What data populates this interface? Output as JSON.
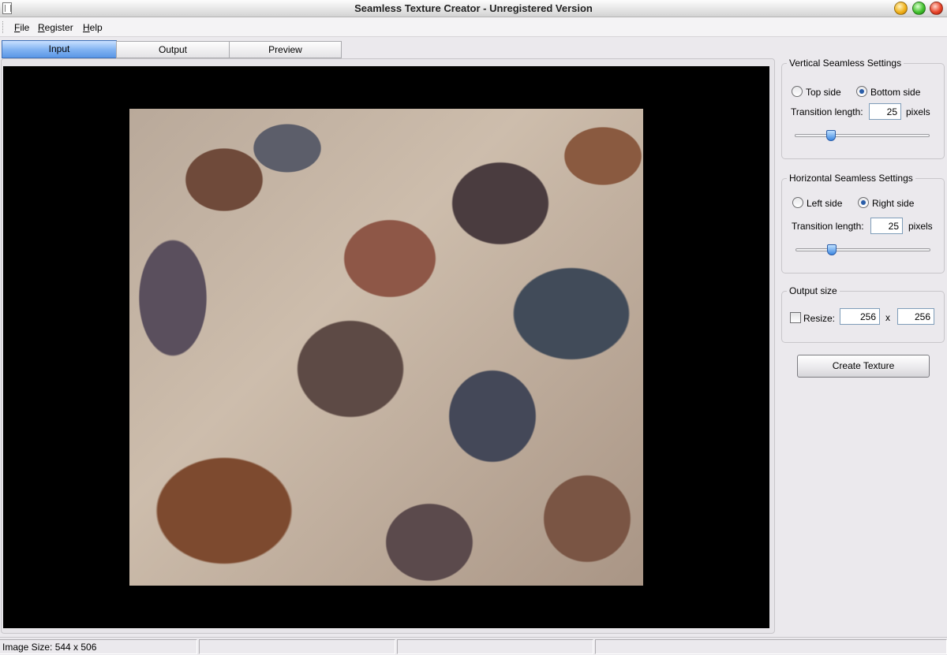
{
  "window": {
    "title": "Seamless Texture Creator - Unregistered Version"
  },
  "menu": {
    "items": [
      "File",
      "Register",
      "Help"
    ]
  },
  "tabs": [
    {
      "label": "Input",
      "active": true
    },
    {
      "label": "Output",
      "active": false
    },
    {
      "label": "Preview",
      "active": false
    }
  ],
  "vertical": {
    "title": "Vertical Seamless Settings",
    "option_top": "Top side",
    "option_bottom": "Bottom side",
    "selected": "Bottom side",
    "transition_label": "Transition length:",
    "transition_value": "25",
    "units": "pixels",
    "slider_fraction": 0.25
  },
  "horizontal": {
    "title": "Horizontal Seamless Settings",
    "option_left": "Left side",
    "option_right": "Right side",
    "selected": "Right side",
    "transition_label": "Transition length:",
    "transition_value": "25",
    "units": "pixels",
    "slider_fraction": 0.25
  },
  "output_size": {
    "title": "Output size",
    "resize_label": "Resize:",
    "resize_checked": false,
    "width": "256",
    "separator": "x",
    "height": "256"
  },
  "create_button": "Create Texture",
  "status": {
    "image_size": "Image Size: 544 x 506"
  },
  "colors": {
    "accent": "#5a97e6",
    "canvas_bg": "#000000",
    "window_bg": "#ebe9ed"
  }
}
